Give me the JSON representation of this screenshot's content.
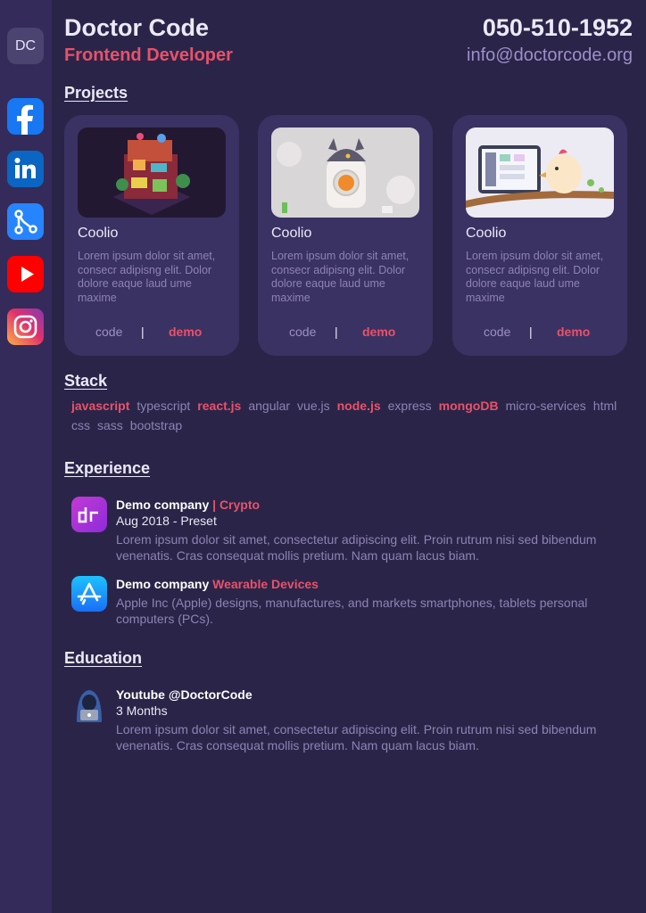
{
  "profile": {
    "initials": "DC",
    "name": "Doctor Code",
    "role": "Frontend Developer",
    "phone": "050-510-1952",
    "email": "info@doctorcode.org"
  },
  "social": [
    {
      "name": "facebook",
      "icon": "facebook-icon",
      "color": "#1877f2"
    },
    {
      "name": "linkedin",
      "icon": "linkedin-icon",
      "color": "#0a66c2"
    },
    {
      "name": "sourcetree",
      "icon": "sourcetree-icon",
      "color": "#2684ff"
    },
    {
      "name": "youtube",
      "icon": "youtube-icon",
      "color": "#ff0000"
    },
    {
      "name": "instagram",
      "icon": "instagram-icon",
      "color": "#e1306c"
    }
  ],
  "sections": {
    "projects": "Projects",
    "stack": "Stack",
    "experience": "Experience",
    "education": "Education"
  },
  "projects": [
    {
      "title": "Coolio",
      "description": "Lorem ipsum dolor sit amet, consecr adipisng elit. Dolor dolore eaque laud ume maxime",
      "code_label": "code",
      "separator": "|",
      "demo_label": "demo"
    },
    {
      "title": "Coolio",
      "description": "Lorem ipsum dolor sit amet, consecr adipisng elit. Dolor dolore eaque laud ume maxime",
      "code_label": "code",
      "separator": "|",
      "demo_label": "demo"
    },
    {
      "title": "Coolio",
      "description": "Lorem ipsum dolor sit amet, consecr adipisng elit. Dolor dolore eaque laud ume maxime",
      "code_label": "code",
      "separator": "|",
      "demo_label": "demo"
    }
  ],
  "stack": [
    {
      "label": "javascript",
      "highlight": true
    },
    {
      "label": "typescript",
      "highlight": false
    },
    {
      "label": "react.js",
      "highlight": true
    },
    {
      "label": "angular",
      "highlight": false
    },
    {
      "label": "vue.js",
      "highlight": false
    },
    {
      "label": "node.js",
      "highlight": true
    },
    {
      "label": "express",
      "highlight": false
    },
    {
      "label": "mongoDB",
      "highlight": true
    },
    {
      "label": "micro-services",
      "highlight": false
    },
    {
      "label": "html",
      "highlight": false
    },
    {
      "label": "css",
      "highlight": false
    },
    {
      "label": "sass",
      "highlight": false
    },
    {
      "label": "bootstrap",
      "highlight": false
    }
  ],
  "experience": [
    {
      "company": "Demo company",
      "accent": "| Crypto",
      "period": "Aug 2018 - Preset",
      "description": "Lorem ipsum dolor sit amet, consectetur adipiscing elit. Proin rutrum nisi sed bibendum venenatis. Cras consequat mollis pretium. Nam quam lacus biam.",
      "icon": "dr-logo-icon"
    },
    {
      "company": "Demo company",
      "accent": "Wearable Devices",
      "description": "Apple Inc (Apple) designs, manufactures, and markets smartphones, tablets personal computers (PCs).",
      "icon": "app-store-icon"
    }
  ],
  "education": [
    {
      "title": "Youtube @DoctorCode",
      "period": "3 Months",
      "description": "Lorem ipsum dolor sit amet, consectetur adipiscing elit. Proin rutrum nisi sed bibendum venenatis. Cras consequat mollis pretium. Nam quam lacus biam.",
      "icon": "hacker-icon"
    }
  ],
  "colors": {
    "background": "#2a2548",
    "sidebar": "#342b5a",
    "card": "#3a3263",
    "accent": "#e9516a",
    "muted": "#8d83b3"
  }
}
